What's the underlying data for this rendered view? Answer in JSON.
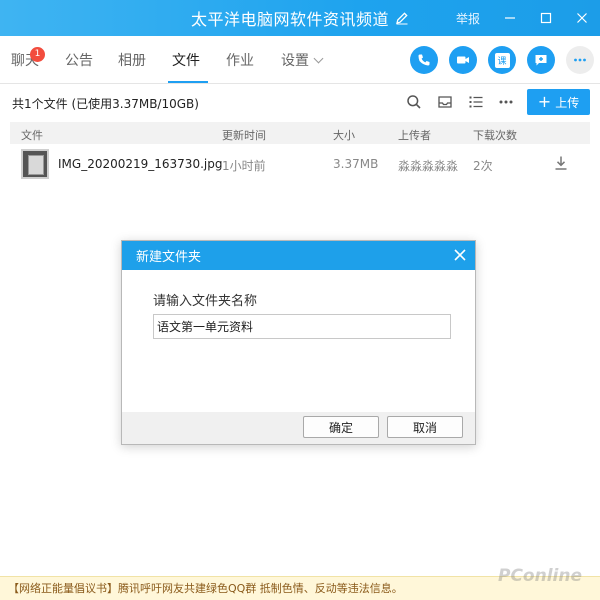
{
  "window": {
    "title": "太平洋电脑网软件资讯频道",
    "report_label": "举报"
  },
  "tabs": [
    {
      "label": "聊天",
      "badge": "1"
    },
    {
      "label": "公告"
    },
    {
      "label": "相册"
    },
    {
      "label": "文件",
      "active": true
    },
    {
      "label": "作业"
    },
    {
      "label": "设置"
    }
  ],
  "header_actions": [
    {
      "icon": "phone-icon"
    },
    {
      "icon": "video-icon"
    },
    {
      "icon": "class-icon",
      "label": "课"
    },
    {
      "icon": "add-chat-icon"
    },
    {
      "icon": "more-icon"
    }
  ],
  "toolbar": {
    "summary": "共1个文件 (已使用3.37MB/10GB)",
    "upload_label": "上传",
    "icons": [
      "search-icon",
      "inbox-icon",
      "list-view-icon",
      "more-icon"
    ]
  },
  "table": {
    "columns": [
      "文件",
      "更新时间",
      "大小",
      "上传者",
      "下载次数"
    ],
    "rows": [
      {
        "name": "IMG_20200219_163730.jpg",
        "updated": "1小时前",
        "size": "3.37MB",
        "uploader": "淼淼淼淼淼",
        "downloads": "2次"
      }
    ]
  },
  "dialog": {
    "title": "新建文件夹",
    "prompt": "请输入文件夹名称",
    "input_value": "语文第一单元资料",
    "confirm_label": "确定",
    "cancel_label": "取消"
  },
  "notice": "【网络正能量倡议书】腾讯呼吁网友共建绿色QQ群 抵制色情、反动等违法信息。",
  "watermark": "PConline",
  "colors": {
    "accent": "#1e9ff2",
    "titlebar": "#1ea3ee",
    "badge": "#f24d3e",
    "notice_bg": "#fff7d9"
  }
}
